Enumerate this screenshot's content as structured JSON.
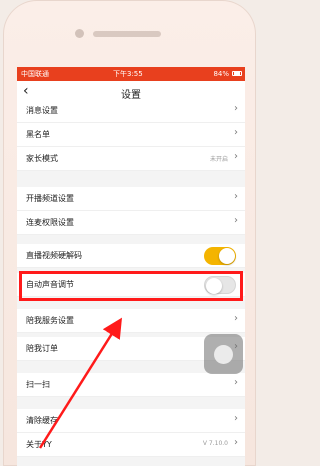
{
  "statusbar": {
    "carrier": "中国联通",
    "time": "下午3:55",
    "battery": "84%"
  },
  "navbar": {
    "back_icon": "chevron-left-icon",
    "title": "设置"
  },
  "rows": [
    {
      "label": "消息设置",
      "type": "chevron"
    },
    {
      "label": "黑名单",
      "type": "chevron"
    },
    {
      "label": "家长模式",
      "value": "未开启",
      "type": "chevron"
    },
    {
      "label": "开播频道设置",
      "type": "chevron"
    },
    {
      "label": "连麦权限设置",
      "type": "chevron"
    },
    {
      "label": "直播视频硬解码",
      "type": "toggle",
      "state": "on"
    },
    {
      "label": "自动声音调节",
      "type": "toggle",
      "state": "off"
    },
    {
      "label": "陪我服务设置",
      "type": "chevron"
    },
    {
      "label": "陪我订单",
      "type": "chevron"
    },
    {
      "label": "扫一扫",
      "type": "chevron"
    },
    {
      "label": "清除缓存",
      "type": "chevron"
    },
    {
      "label": "关于YY",
      "value": "V 7.10.0",
      "type": "chevron"
    }
  ],
  "colors": {
    "statusbar": "#e8401e",
    "toggle_on": "#f4b400",
    "highlight": "#ff1a1a"
  }
}
